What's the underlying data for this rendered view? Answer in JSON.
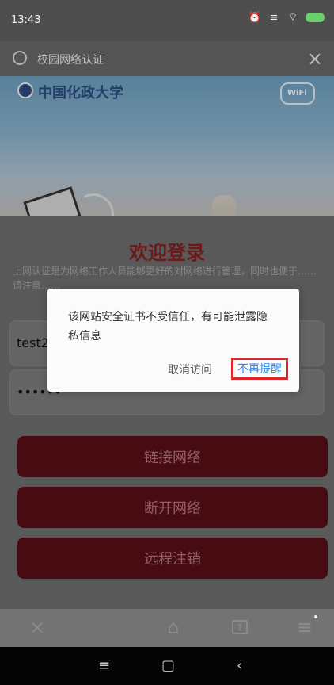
{
  "statusbar": {
    "time": "13:43"
  },
  "addressbar": {
    "url": "校园网络认证"
  },
  "banner": {
    "logo_text": "中国化政大学",
    "wifi_text": "WiFi"
  },
  "login": {
    "title": "欢迎登录",
    "intro": "上网认证是为网络工作人员能够更好的对网络进行管理，同时也便于……请注意……",
    "username": "test2",
    "password": "••••••",
    "buttons": [
      "链接网络",
      "断开网络",
      "远程注销"
    ]
  },
  "dialog": {
    "message": "该网站安全证书不受信任，有可能泄露隐私信息",
    "cancel": "取消访问",
    "confirm": "不再提醒"
  },
  "toolbar": {
    "tabs_count": "1"
  },
  "icons": {
    "status_icons": [
      "alarm-icon",
      "sim-icon",
      "wifi-icon",
      "battery-icon"
    ],
    "browser_tools": [
      "back-icon",
      "forward-icon",
      "home-icon",
      "tabs-icon",
      "menu-icon"
    ],
    "system_nav": [
      "recent-apps-icon",
      "home-button-icon",
      "back-button-icon"
    ]
  }
}
